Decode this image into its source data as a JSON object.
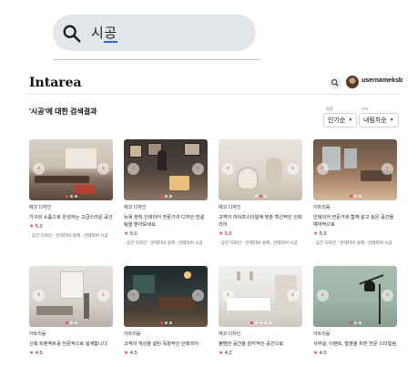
{
  "search": {
    "query_prefix": "시",
    "query_underlined": "공"
  },
  "header": {
    "brand": "Intarea",
    "username": "usernameksb"
  },
  "results": {
    "title": "'시공'에 대한 검색결과"
  },
  "filters": [
    {
      "label": "정렬",
      "value": "인기순"
    },
    {
      "label": "순서",
      "value": "내림차순"
    }
  ],
  "colors": {
    "accent": "#e2476a",
    "search_bg": "#e3e7ec"
  },
  "cards": [
    {
      "category": "에코 디자인",
      "description": "가구와 소품으로 완성하는 고급스러운 공간",
      "rating": "5.0",
      "tags": "- 공간 디자인 - 인테리어 설계 - 인테리어 시공"
    },
    {
      "category": "에코 디자인",
      "description": "뉴욕 현직 인테리어 전문가의 디자인 컨설팅을 받아보세요.",
      "rating": "5.0",
      "tags": "- 공간 디자인 - 인테리어 설계 - 인테리어 시공"
    },
    {
      "category": "에코 디자인",
      "description": "고객의 라이프스타일에 맞춘 혁신적인 인테리어",
      "rating": "5.0",
      "tags": "- 공간 디자인 - 인테리어 설계 - 인테리어 시공"
    },
    {
      "category": "아트리움",
      "description": "인테리어 전문가와 함께 살고 싶은 공간을 예약적으로",
      "rating": "5.0",
      "tags": "- 공간 디자인 - 인테리어 설계 - 인테리어 시공"
    },
    {
      "category": "아트리움",
      "description": "신축 트렌젝트를 전문적으로 설계합니다.",
      "rating": "4.5",
      "tags": ""
    },
    {
      "category": "아트리움",
      "description": "고객의 개성을 살린 독창적인 인테리어",
      "rating": "4.5",
      "tags": ""
    },
    {
      "category": "에코 디자인",
      "description": "평범한 공간을 감각적인 공간으로",
      "rating": "4.2",
      "tags": ""
    },
    {
      "category": "아트리움",
      "description": "사무실, 이벤트, 촬영을 위한 전문 스타일링",
      "rating": "4.0",
      "tags": ""
    }
  ]
}
